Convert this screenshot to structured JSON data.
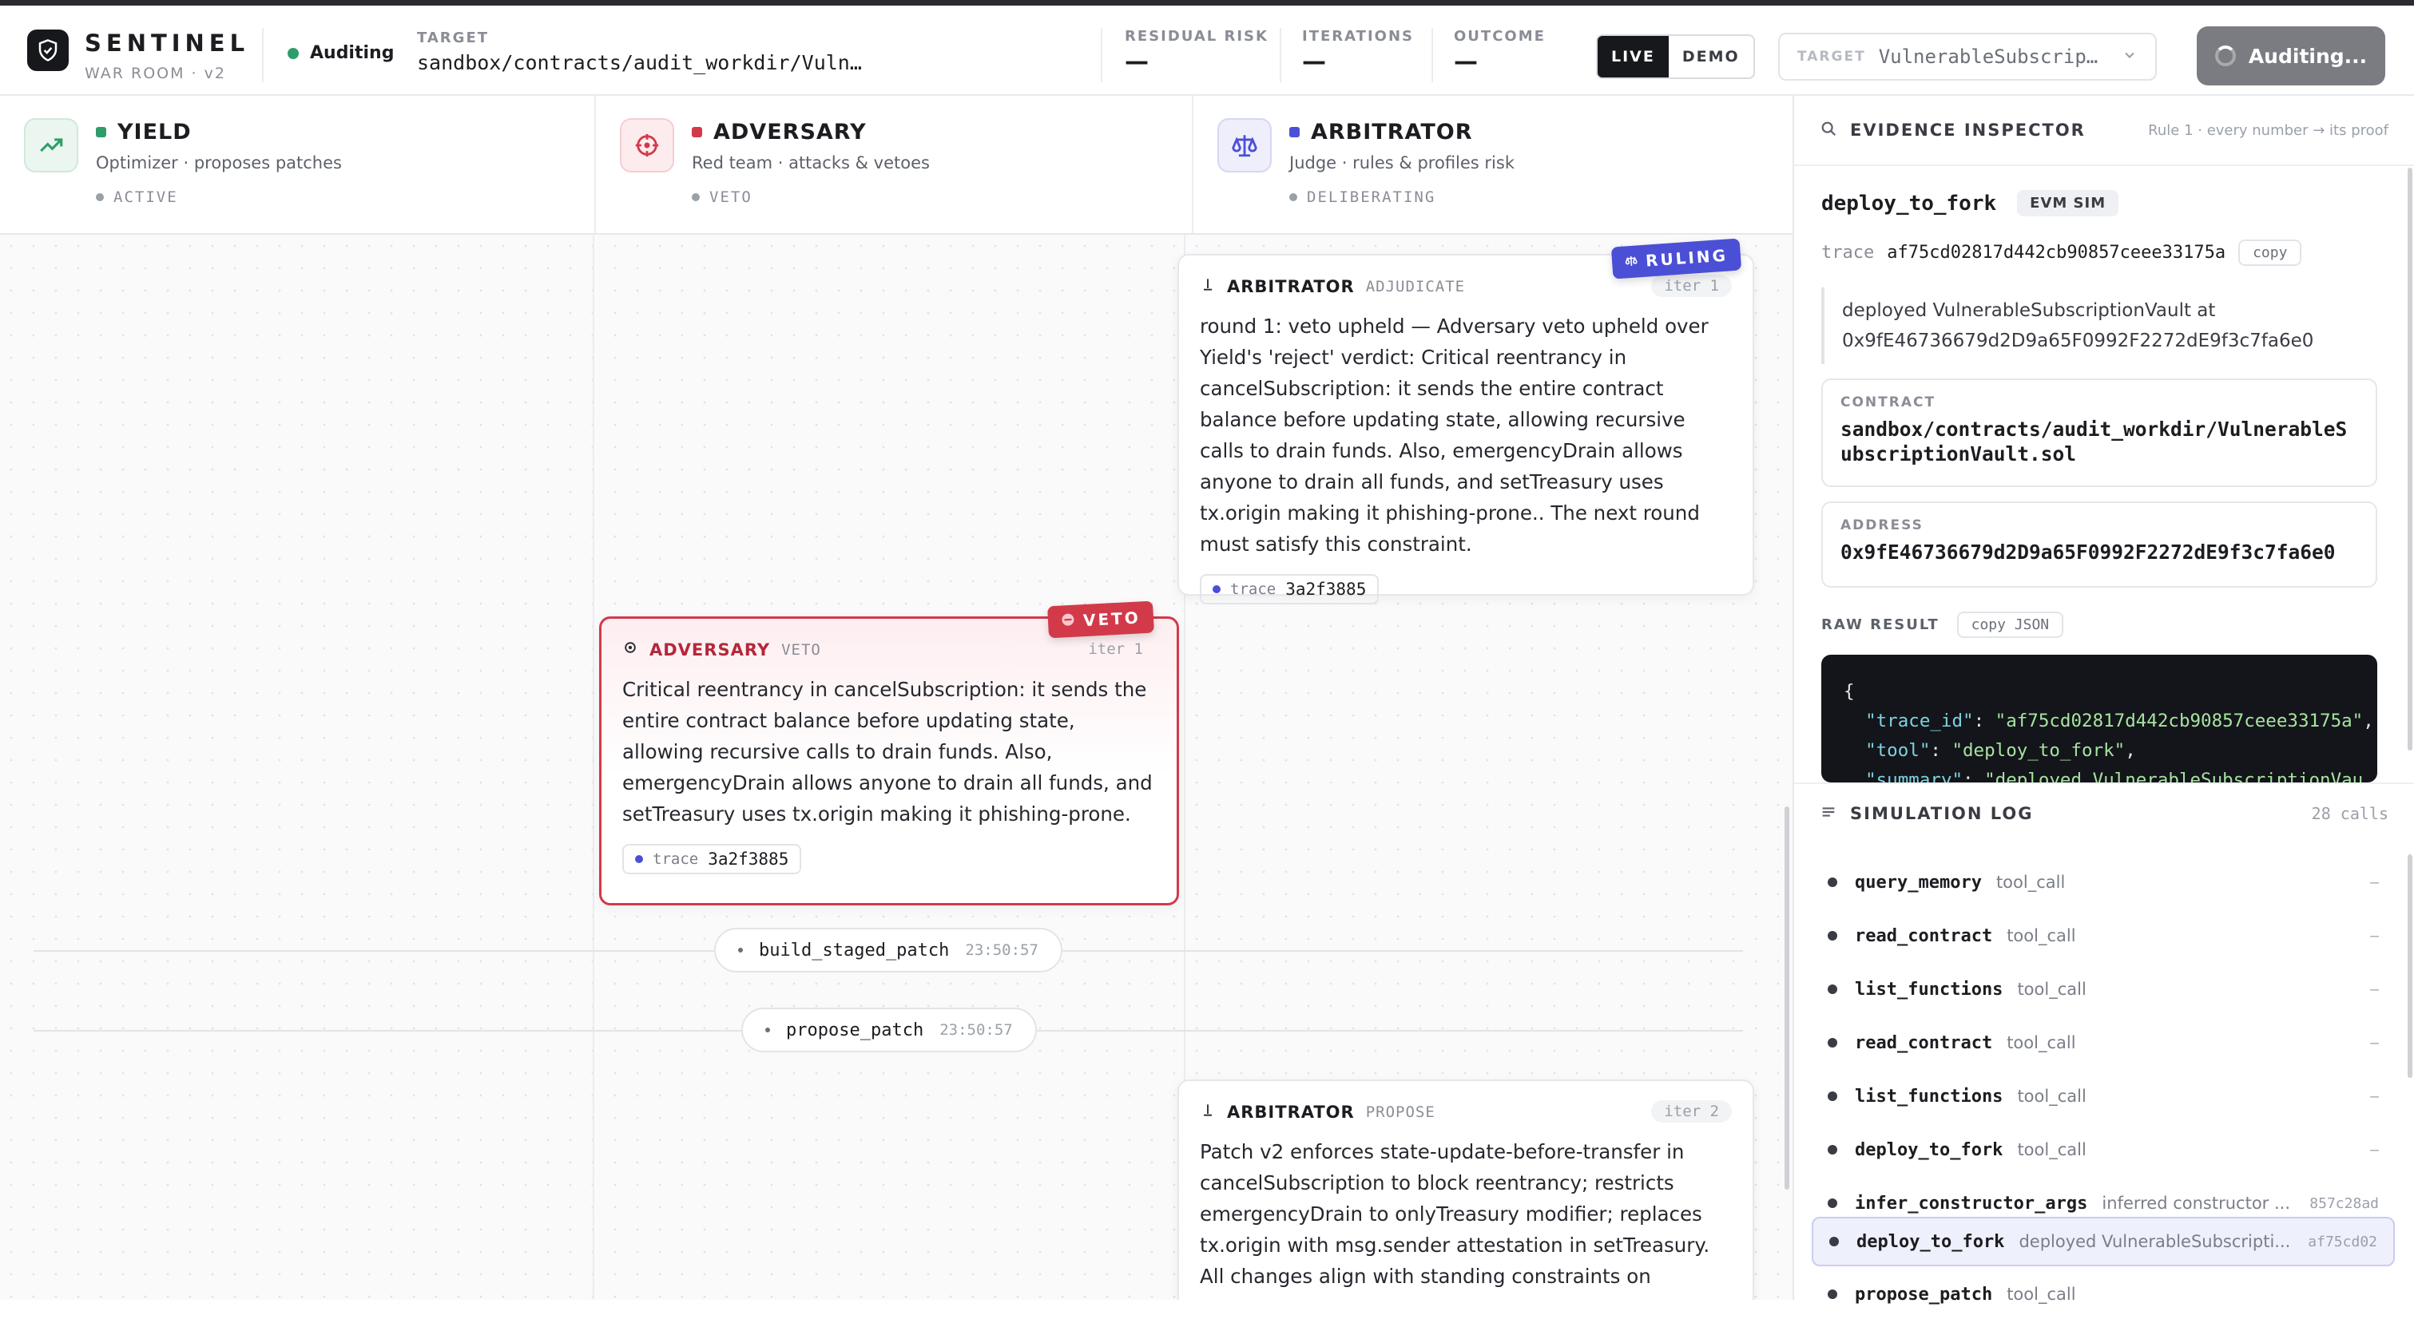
{
  "brand": {
    "name": "SENTINEL",
    "subtitle": "WAR ROOM · v2"
  },
  "status": {
    "label": "Auditing",
    "color": "#2f9d6a"
  },
  "target": {
    "label": "TARGET",
    "value": "sandbox/contracts/audit_workdir/Vuln…"
  },
  "metrics": [
    {
      "label": "RESIDUAL RISK",
      "value": "—"
    },
    {
      "label": "ITERATIONS",
      "value": "—"
    },
    {
      "label": "OUTCOME",
      "value": "—"
    }
  ],
  "mode_toggle": {
    "live": "LIVE",
    "demo": "DEMO",
    "selected": "LIVE"
  },
  "target_select": {
    "label": "TARGET",
    "value": "VulnerableSubscrip…"
  },
  "audit_button": {
    "label": "Auditing..."
  },
  "agents": [
    {
      "name": "YIELD",
      "desc": "Optimizer · proposes patches",
      "state": "ACTIVE",
      "color": "#2f9d6a",
      "icon": "trending-up-icon"
    },
    {
      "name": "ADVERSARY",
      "desc": "Red team · attacks & vetoes",
      "state": "VETO",
      "color": "#d23a4a",
      "icon": "crosshair-icon"
    },
    {
      "name": "ARBITRATOR",
      "desc": "Judge · rules & profiles risk",
      "state": "DELIBERATING",
      "color": "#4b4fd6",
      "icon": "scale-icon"
    }
  ],
  "cards": {
    "ruling": {
      "badge": "RULING",
      "who": "ARBITRATOR",
      "kind": "ADJUDICATE",
      "iter": "iter 1",
      "body": "round 1: veto upheld — Adversary veto upheld over Yield's 'reject' verdict: Critical reentrancy in cancelSubscription: it sends the entire contract balance before updating state, allowing recursive calls to drain funds. Also, emergencyDrain allows anyone to drain all funds, and setTreasury uses tx.origin making it phishing-prone.. The next round must satisfy this constraint.",
      "trace_label": "trace",
      "trace": "3a2f3885"
    },
    "veto": {
      "badge": "VETO",
      "who": "ADVERSARY",
      "kind": "VETO",
      "iter": "iter 1",
      "body": "Critical reentrancy in cancelSubscription: it sends the entire contract balance before updating state, allowing recursive calls to drain funds. Also, emergencyDrain allows anyone to drain all funds, and setTreasury uses tx.origin making it phishing-prone.",
      "trace_label": "trace",
      "trace": "3a2f3885"
    },
    "propose": {
      "who": "ARBITRATOR",
      "kind": "PROPOSE",
      "iter": "iter 2",
      "body": "Patch v2 enforces state-update-before-transfer in cancelSubscription to block reentrancy; restricts emergencyDrain to onlyTreasury modifier; replaces tx.origin with msg.sender attestation in setTreasury. All changes align with standing constraints on"
    }
  },
  "steps": [
    {
      "name": "build_staged_patch",
      "time": "23:50:57"
    },
    {
      "name": "propose_patch",
      "time": "23:50:57"
    }
  ],
  "inspector": {
    "title": "EVIDENCE INSPECTOR",
    "rule": "Rule 1 · every number → its proof",
    "tool": "deploy_to_fork",
    "tag": "EVM SIM",
    "trace_label": "trace",
    "trace": "af75cd02817d442cb90857ceee33175a",
    "copy": "copy",
    "summary": "deployed VulnerableSubscriptionVault at 0x9fE46736679d2D9a65F0992F2272dE9f3c7fa6e0",
    "contract_label": "CONTRACT",
    "contract": "sandbox/contracts/audit_workdir/VulnerableSubscriptionVault.sol",
    "address_label": "ADDRESS",
    "address": "0x9fE46736679d2D9a65F0992F2272dE9f3c7fa6e0",
    "raw_label": "RAW RESULT",
    "copy_json": "copy JSON",
    "raw": {
      "open": "{",
      "k1": "\"trace_id\"",
      "v1": "\"af75cd02817d442cb90857ceee33175a\"",
      "k2": "\"tool\"",
      "v2": "\"deploy_to_fork\"",
      "k3": "\"summary\"",
      "v3": "\"deployed VulnerableSubscriptionVau"
    }
  },
  "simlog": {
    "title": "SIMULATION LOG",
    "count": "28 calls",
    "rows": [
      {
        "fn": "query_memory",
        "type": "tool_call",
        "trace": "—"
      },
      {
        "fn": "read_contract",
        "type": "tool_call",
        "trace": "—"
      },
      {
        "fn": "list_functions",
        "type": "tool_call",
        "trace": "—"
      },
      {
        "fn": "read_contract",
        "type": "tool_call",
        "trace": "—"
      },
      {
        "fn": "list_functions",
        "type": "tool_call",
        "trace": "—"
      },
      {
        "fn": "deploy_to_fork",
        "type": "tool_call",
        "trace": "—"
      },
      {
        "fn": "infer_constructor_args",
        "type": "inferred constructor ...",
        "trace": "857c28ad"
      },
      {
        "fn": "deploy_to_fork",
        "type": "deployed VulnerableSubscripti...",
        "trace": "af75cd02"
      },
      {
        "fn": "propose_patch",
        "type": "tool_call",
        "trace": ""
      }
    ]
  }
}
